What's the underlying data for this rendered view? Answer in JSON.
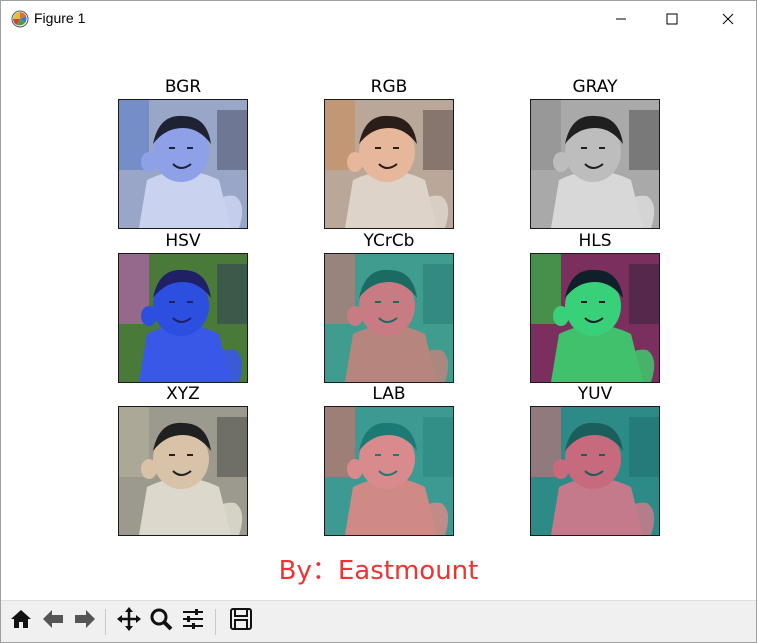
{
  "window": {
    "title": "Figure 1",
    "icon": "matplotlib-icon",
    "controls": [
      "minimize-icon",
      "maximize-icon",
      "close-icon"
    ]
  },
  "figure": {
    "subplots": [
      {
        "title": "BGR",
        "palette": {
          "bg": "#9aa6c8",
          "face": "#8ea0e8",
          "shirt": "#c9d2ee",
          "hair": "#1e2233",
          "accent": "#5a7ac8"
        }
      },
      {
        "title": "RGB",
        "palette": {
          "bg": "#b9a79a",
          "face": "#e6b79a",
          "shirt": "#ddd3c9",
          "hair": "#2a1e1a",
          "accent": "#c88a5a"
        }
      },
      {
        "title": "GRAY",
        "palette": {
          "bg": "#a9a9a9",
          "face": "#bdbdbd",
          "shirt": "#d8d8d8",
          "hair": "#1f1f1f",
          "accent": "#8a8a8a"
        }
      },
      {
        "title": "HSV",
        "palette": {
          "bg": "#4a7a3a",
          "face": "#2c4fe0",
          "shirt": "#3a58e8",
          "hair": "#202066",
          "accent": "#d35bd0"
        }
      },
      {
        "title": "YCrCb",
        "palette": {
          "bg": "#3f9c8f",
          "face": "#c97b84",
          "shirt": "#b6857d",
          "hair": "#1b6b63",
          "accent": "#e17070"
        }
      },
      {
        "title": "HLS",
        "palette": {
          "bg": "#7a2f5f",
          "face": "#39d07a",
          "shirt": "#41c16b",
          "hair": "#10202a",
          "accent": "#1ee03c"
        }
      },
      {
        "title": "XYZ",
        "palette": {
          "bg": "#9c9a8e",
          "face": "#d8c2a8",
          "shirt": "#dcd8cc",
          "hair": "#202020",
          "accent": "#bab49e"
        }
      },
      {
        "title": "LAB",
        "palette": {
          "bg": "#3c9a92",
          "face": "#d98a8c",
          "shirt": "#cf8a86",
          "hair": "#1c7a74",
          "accent": "#ef6a63"
        }
      },
      {
        "title": "YUV",
        "palette": {
          "bg": "#2c8b86",
          "face": "#c86a7e",
          "shirt": "#c47a8a",
          "hair": "#1b5f5c",
          "accent": "#e46e78"
        }
      }
    ],
    "caption": "By：Eastmount"
  },
  "toolbar": {
    "tools": [
      {
        "name": "home-icon"
      },
      {
        "name": "back-arrow-icon"
      },
      {
        "name": "forward-arrow-icon"
      },
      {
        "name": "pan-icon"
      },
      {
        "name": "zoom-icon"
      },
      {
        "name": "configure-subplots-icon"
      },
      {
        "name": "save-icon"
      }
    ]
  }
}
